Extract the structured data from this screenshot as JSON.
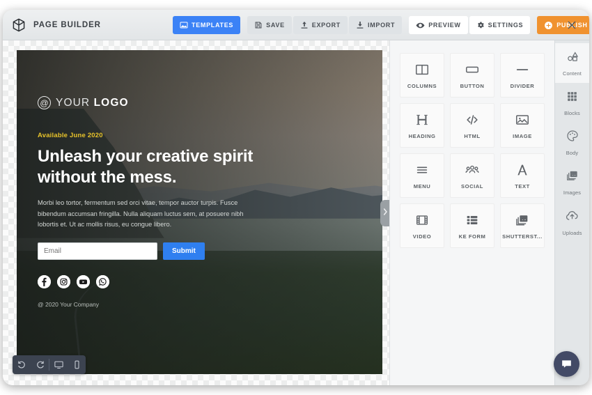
{
  "app": {
    "brand_title": "PAGE BUILDER",
    "brand_icon": "cube-icon",
    "close_icon": "close-icon"
  },
  "toolbar": {
    "buttons": [
      {
        "label": "TEMPLATES",
        "icon": "image-icon",
        "style": "primary"
      },
      {
        "label": "SAVE",
        "icon": "floppy-icon",
        "style": "group"
      },
      {
        "label": "EXPORT",
        "icon": "upload-icon",
        "style": "group"
      },
      {
        "label": "IMPORT",
        "icon": "download-icon",
        "style": "group"
      },
      {
        "label": "PREVIEW",
        "icon": "eye-icon",
        "style": "white"
      },
      {
        "label": "SETTINGS",
        "icon": "gear-icon",
        "style": "white"
      },
      {
        "label": "PUBLISH",
        "icon": "plus-circle-icon",
        "style": "accent"
      }
    ],
    "colors": {
      "primary": "#3b82f6",
      "accent": "#f0922f",
      "bar_background": "#e6e9eb"
    }
  },
  "canvas": {
    "hero": {
      "logo_at": "@",
      "logo_text": "YOUR ",
      "logo_text_bold": "LOGO",
      "kicker": "Available June 2020",
      "kicker_color": "#e8c32a",
      "headline": "Unleash your creative spirit without the mess.",
      "subcopy": "Morbi leo tortor, fermentum sed orci vitae, tempor auctor turpis. Fusce bibendum accumsan fringilla. Nulla aliquam luctus sem, at posuere nibh lobortis et. Ut ac mollis risus, eu congue libero.",
      "email_placeholder": "Email",
      "email_value": "",
      "submit_label": "Submit",
      "submit_color": "#2f7ff0",
      "social": [
        {
          "name": "facebook-icon"
        },
        {
          "name": "instagram-icon"
        },
        {
          "name": "youtube-icon"
        },
        {
          "name": "whatsapp-icon"
        }
      ],
      "copyright": "@ 2020 Your Company"
    },
    "mini_toolbar": [
      {
        "name": "undo-icon"
      },
      {
        "name": "redo-icon"
      },
      {
        "name": "desktop-view-icon"
      },
      {
        "name": "mobile-view-icon"
      }
    ],
    "panel_handle_icon": "chevron-right-icon"
  },
  "blocks_panel": {
    "tiles": [
      {
        "label": "COLUMNS",
        "icon": "columns-icon"
      },
      {
        "label": "BUTTON",
        "icon": "button-icon"
      },
      {
        "label": "DIVIDER",
        "icon": "divider-icon"
      },
      {
        "label": "HEADING",
        "icon": "heading-icon"
      },
      {
        "label": "HTML",
        "icon": "code-icon"
      },
      {
        "label": "IMAGE",
        "icon": "image-icon"
      },
      {
        "label": "MENU",
        "icon": "menu-icon"
      },
      {
        "label": "SOCIAL",
        "icon": "social-icon"
      },
      {
        "label": "TEXT",
        "icon": "text-icon"
      },
      {
        "label": "VIDEO",
        "icon": "video-icon"
      },
      {
        "label": "KE FORM",
        "icon": "form-icon"
      },
      {
        "label": "SHUTTERST...",
        "icon": "photos-icon"
      }
    ]
  },
  "side_rail": {
    "items": [
      {
        "label": "Content",
        "icon": "shapes-icon",
        "active": true
      },
      {
        "label": "Blocks",
        "icon": "grid-icon",
        "active": false
      },
      {
        "label": "Body",
        "icon": "palette-icon",
        "active": false
      },
      {
        "label": "Images",
        "icon": "photos-icon",
        "active": false
      },
      {
        "label": "Uploads",
        "icon": "cloud-upload-icon",
        "active": false
      }
    ]
  },
  "chat": {
    "icon": "chat-bubble-icon"
  }
}
